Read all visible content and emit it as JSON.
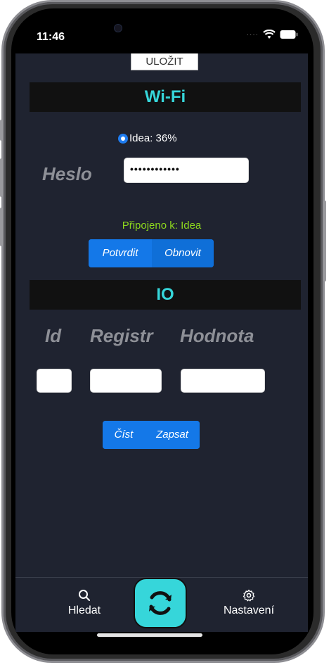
{
  "status": {
    "time": "11:46"
  },
  "header": {
    "save_label": "ULOŽIT"
  },
  "wifi": {
    "title": "Wi-Fi",
    "network_label": "Idea: 36%",
    "password_label": "Heslo",
    "password_value": "••••••••••••",
    "connected_text": "Připojeno k: Idea",
    "confirm_label": "Potvrdit",
    "refresh_label": "Obnovit"
  },
  "io": {
    "title": "IO",
    "col_id": "Id",
    "col_register": "Registr",
    "col_value": "Hodnota",
    "id_value": "",
    "register_value": "",
    "value_value": "",
    "read_label": "Číst",
    "write_label": "Zapsat"
  },
  "tabs": [
    {
      "label": "Hledat",
      "icon": "search-icon"
    },
    {
      "label": "",
      "icon": "sync-icon"
    },
    {
      "label": "Nastavení",
      "icon": "gear-icon"
    }
  ],
  "colors": {
    "accent": "#36d6da",
    "primary_button": "#1478e8",
    "connected": "#8dd81d",
    "background": "#1f2330"
  }
}
